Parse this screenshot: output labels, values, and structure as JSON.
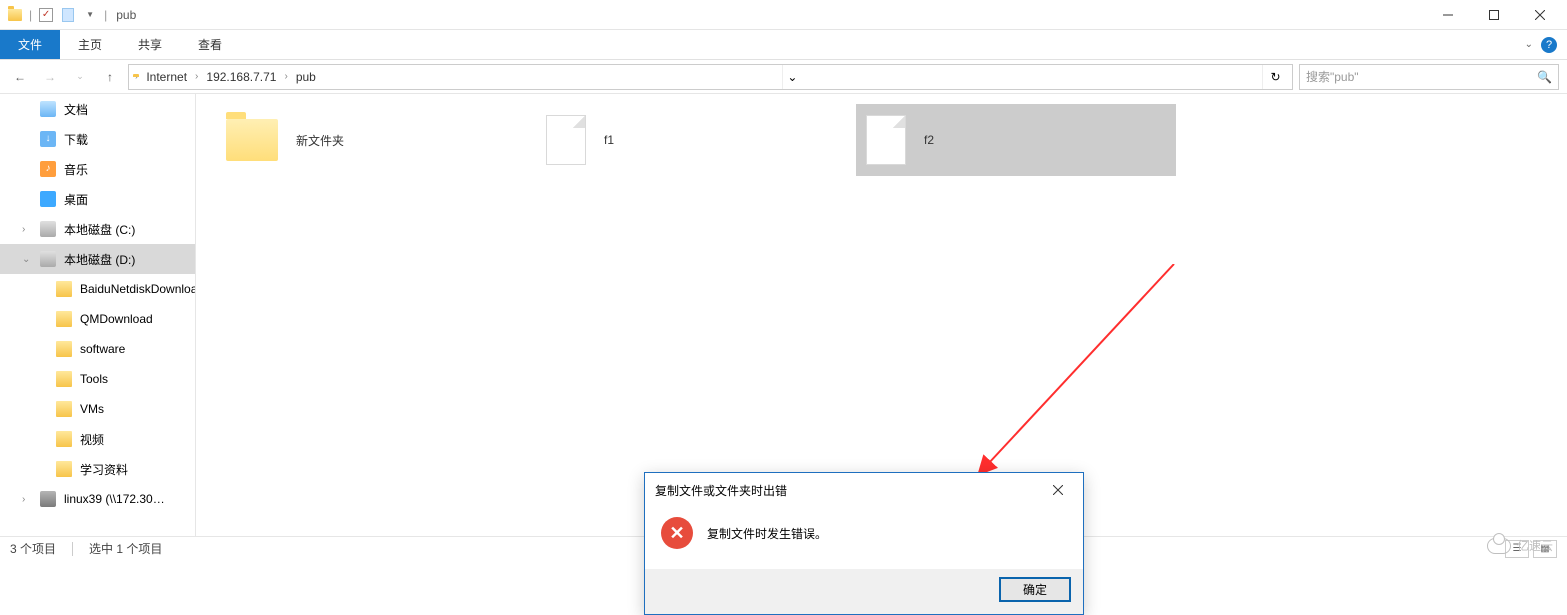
{
  "titlebar": {
    "title": "pub"
  },
  "ribbon": {
    "tabs": {
      "file": "文件",
      "home": "主页",
      "share": "共享",
      "view": "查看"
    }
  },
  "breadcrumbs": [
    "Internet",
    "192.168.7.71",
    "pub"
  ],
  "search": {
    "placeholder": "搜索\"pub\""
  },
  "tree": {
    "items": [
      {
        "label": "文档",
        "icon": "doc"
      },
      {
        "label": "下载",
        "icon": "dl"
      },
      {
        "label": "音乐",
        "icon": "music"
      },
      {
        "label": "桌面",
        "icon": "desk"
      },
      {
        "label": "本地磁盘 (C:)",
        "icon": "disk",
        "expandable": true
      },
      {
        "label": "本地磁盘 (D:)",
        "icon": "disk",
        "expandable": true,
        "selected": true
      },
      {
        "label": "BaiduNetdiskDownload",
        "icon": "fold",
        "indent": true
      },
      {
        "label": "QMDownload",
        "icon": "fold",
        "indent": true
      },
      {
        "label": "software",
        "icon": "fold",
        "indent": true
      },
      {
        "label": "Tools",
        "icon": "fold",
        "indent": true
      },
      {
        "label": "VMs",
        "icon": "fold",
        "indent": true
      },
      {
        "label": "视频",
        "icon": "fold",
        "indent": true
      },
      {
        "label": "学习资料",
        "icon": "fold",
        "indent": true
      },
      {
        "label": "linux39 (\\\\172.30…",
        "icon": "net",
        "expandable": true
      }
    ]
  },
  "content": {
    "items": [
      {
        "label": "新文件夹",
        "type": "folder"
      },
      {
        "label": "f1",
        "type": "file"
      },
      {
        "label": "f2",
        "type": "file",
        "selected": true
      }
    ]
  },
  "dialog": {
    "title": "复制文件或文件夹时出错",
    "message": "复制文件时发生错误。",
    "ok": "确定"
  },
  "status": {
    "count": "3 个项目",
    "selected": "选中 1 个项目"
  },
  "watermark": "亿速云"
}
